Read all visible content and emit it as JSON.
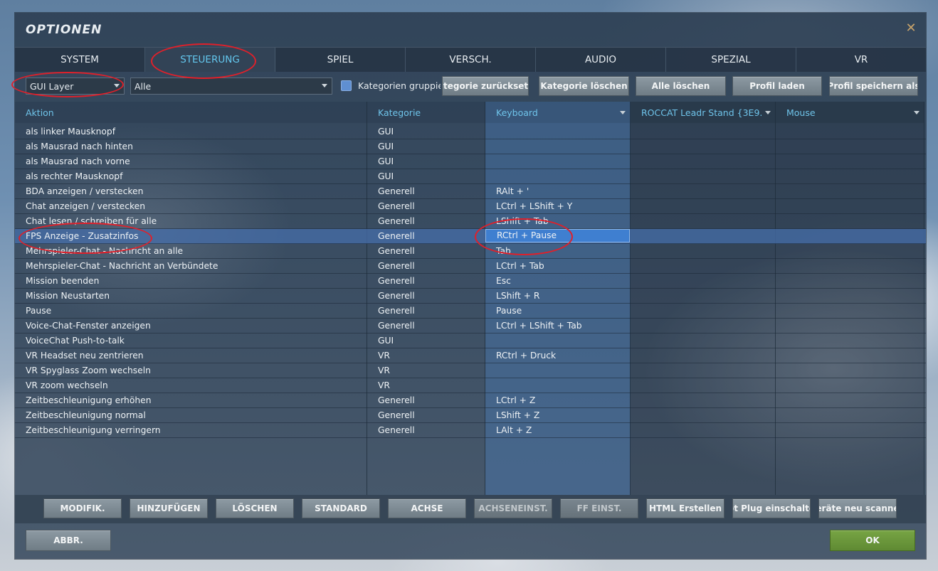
{
  "window": {
    "title": "OPTIONEN"
  },
  "tabs": [
    "SYSTEM",
    "STEUERUNG",
    "SPIEL",
    "VERSCH.",
    "AUDIO",
    "SPEZIAL",
    "VR"
  ],
  "active_tab": "STEUERUNG",
  "toolbar": {
    "layer_select": "GUI Layer",
    "filter_select": "Alle",
    "group_checkbox_label": "Kategorien gruppieren",
    "buttons": [
      "ategorie zurücksetz",
      "Kategorie löschen",
      "Alle löschen",
      "Profil laden",
      "Profil speichern als"
    ]
  },
  "columns": {
    "action": "Aktion",
    "category": "Kategorie",
    "keyboard": "Keyboard",
    "device": "ROCCAT Leadr Stand {3E9...",
    "mouse": "Mouse"
  },
  "rows": [
    {
      "action": "als linker Mausknopf",
      "category": "GUI",
      "keyboard": ""
    },
    {
      "action": "als Mausrad nach hinten",
      "category": "GUI",
      "keyboard": ""
    },
    {
      "action": "als Mausrad nach vorne",
      "category": "GUI",
      "keyboard": ""
    },
    {
      "action": "als rechter Mausknopf",
      "category": "GUI",
      "keyboard": ""
    },
    {
      "action": "BDA anzeigen / verstecken",
      "category": "Generell",
      "keyboard": "RAlt + '"
    },
    {
      "action": "Chat anzeigen / verstecken",
      "category": "Generell",
      "keyboard": "LCtrl + LShift + Y"
    },
    {
      "action": "Chat lesen / schreiben für alle",
      "category": "Generell",
      "keyboard": "LShift + Tab"
    },
    {
      "action": "FPS Anzeige - Zusatzinfos",
      "category": "Generell",
      "keyboard": "RCtrl + Pause"
    },
    {
      "action": "Mehrspieler-Chat - Nachricht an alle",
      "category": "Generell",
      "keyboard": "Tab"
    },
    {
      "action": "Mehrspieler-Chat - Nachricht an Verbündete",
      "category": "Generell",
      "keyboard": "LCtrl + Tab"
    },
    {
      "action": "Mission beenden",
      "category": "Generell",
      "keyboard": "Esc"
    },
    {
      "action": "Mission Neustarten",
      "category": "Generell",
      "keyboard": "LShift + R"
    },
    {
      "action": "Pause",
      "category": "Generell",
      "keyboard": "Pause"
    },
    {
      "action": "Voice-Chat-Fenster anzeigen",
      "category": "Generell",
      "keyboard": "LCtrl + LShift + Tab"
    },
    {
      "action": "VoiceChat Push-to-talk",
      "category": "GUI",
      "keyboard": ""
    },
    {
      "action": "VR Headset neu zentrieren",
      "category": "VR",
      "keyboard": "RCtrl + Druck"
    },
    {
      "action": "VR Spyglass Zoom wechseln",
      "category": "VR",
      "keyboard": ""
    },
    {
      "action": "VR zoom wechseln",
      "category": "VR",
      "keyboard": ""
    },
    {
      "action": "Zeitbeschleunigung erhöhen",
      "category": "Generell",
      "keyboard": "LCtrl + Z"
    },
    {
      "action": "Zeitbeschleunigung normal",
      "category": "Generell",
      "keyboard": "LShift + Z"
    },
    {
      "action": "Zeitbeschleunigung verringern",
      "category": "Generell",
      "keyboard": "LAlt + Z"
    }
  ],
  "selected_row_index": 7,
  "bottom_buttons": [
    {
      "label": "MODIFIK.",
      "disabled": false
    },
    {
      "label": "HINZUFÜGEN",
      "disabled": false
    },
    {
      "label": "LÖSCHEN",
      "disabled": false
    },
    {
      "label": "STANDARD",
      "disabled": false
    },
    {
      "label": "ACHSE",
      "disabled": false
    },
    {
      "label": "ACHSENEINST.",
      "disabled": true
    },
    {
      "label": "FF EINST.",
      "disabled": true
    },
    {
      "label": "HTML Erstellen",
      "disabled": false
    },
    {
      "label": "ot Plug einschalte",
      "disabled": false
    },
    {
      "label": "eräte neu scanne",
      "disabled": false
    }
  ],
  "footer": {
    "cancel": "ABBR.",
    "ok": "OK"
  },
  "colors": {
    "accent": "#63c7ee",
    "ok_green": "#6a9a3c",
    "annotation_red": "#e0202a"
  }
}
